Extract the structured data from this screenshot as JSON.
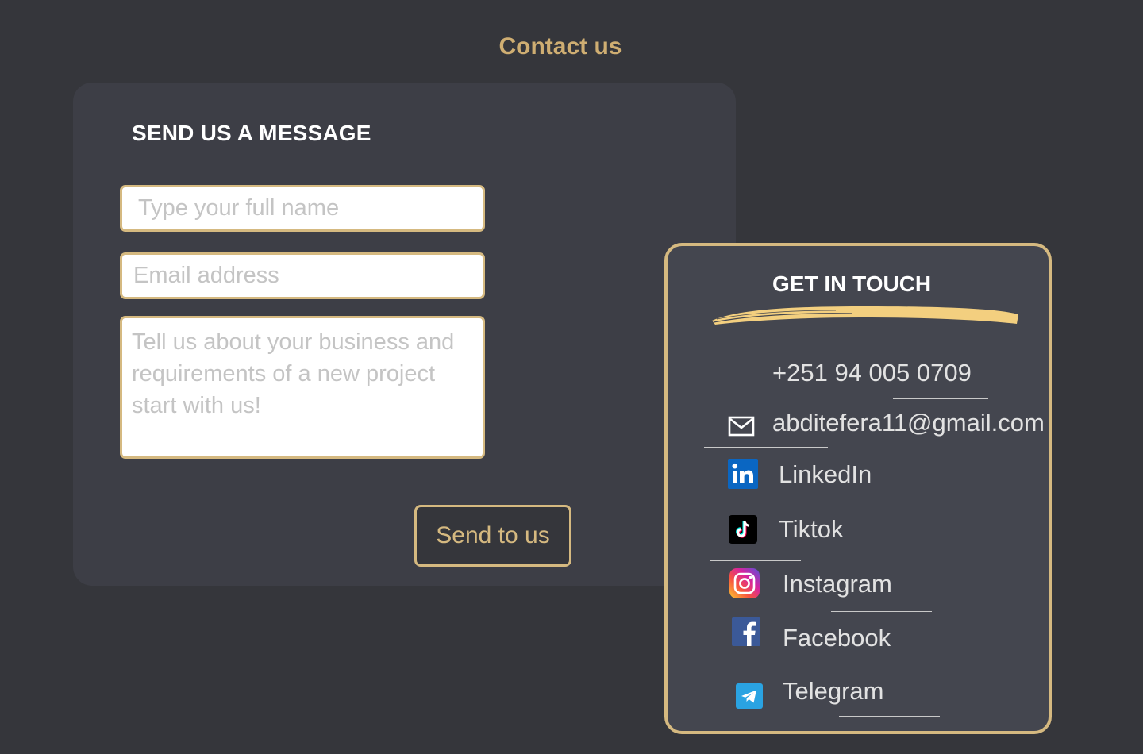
{
  "page": {
    "title": "Contact us"
  },
  "form": {
    "heading": "SEND US A MESSAGE",
    "name_placeholder": "Type your full name",
    "email_placeholder": "Email address",
    "message_placeholder": "Tell us about your business and requirements of a new project start with us!",
    "submit_label": "Send to us"
  },
  "contact": {
    "heading": "GET IN TOUCH",
    "phone": "+251 94 005 0709",
    "email": "abditefera11@gmail.com",
    "links": [
      {
        "label": "LinkedIn",
        "icon": "linkedin-icon"
      },
      {
        "label": "Tiktok",
        "icon": "tiktok-icon"
      },
      {
        "label": "Instagram",
        "icon": "instagram-icon"
      },
      {
        "label": "Facebook",
        "icon": "facebook-icon"
      },
      {
        "label": "Telegram",
        "icon": "telegram-icon"
      }
    ]
  },
  "colors": {
    "background": "#35363b",
    "card": "#3d3e46",
    "accent": "#d5b980",
    "title": "#cfae72",
    "brush": "#f3cf7f"
  }
}
